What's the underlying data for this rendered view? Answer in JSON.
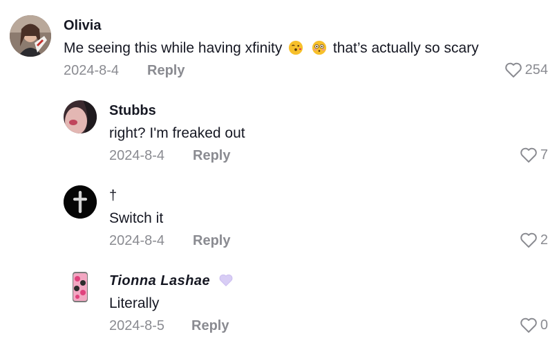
{
  "comments": [
    {
      "author": "Olivia",
      "text_before": "Me seeing this while having xfinity",
      "emoji_1": "kissing-face-emoji",
      "emoji_2": "flushed-face-emoji",
      "text_after": "that’s actually so scary",
      "date": "2024-8-4",
      "reply_label": "Reply",
      "likes": "254"
    },
    {
      "author": "Stubbs",
      "text": "right? I'm freaked out",
      "date": "2024-8-4",
      "reply_label": "Reply",
      "likes": "7"
    },
    {
      "author": "†",
      "text": "Switch it",
      "date": "2024-8-4",
      "reply_label": "Reply",
      "likes": "2"
    },
    {
      "author": "Tionna Lashae",
      "author_badge": "purple-heart-emoji",
      "text": "Literally",
      "date": "2024-8-5",
      "reply_label": "Reply",
      "likes": "0"
    }
  ],
  "colors": {
    "text": "#161823",
    "muted": "#8a8b91",
    "background": "#ffffff"
  }
}
